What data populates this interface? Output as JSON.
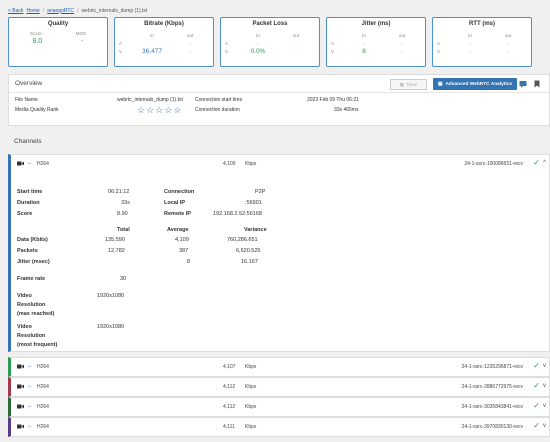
{
  "breadcrumb": {
    "back": "< Back",
    "home": "Home",
    "project": "anangoRTC",
    "file": "webrtc_internals_dump (1).txt"
  },
  "metrics": {
    "quality": {
      "title": "Quality",
      "score_label": "Score",
      "mos_label": "MOS",
      "score": "9.0",
      "mos": "-"
    },
    "bitrate": {
      "title": "Bitrate (Kbps)",
      "in_label": "In",
      "out_label": "out",
      "rows": [
        [
          "A",
          "-",
          "-"
        ],
        [
          "V",
          "36,477",
          "-"
        ]
      ]
    },
    "packet_loss": {
      "title": "Packet Loss",
      "in_label": "In",
      "out_label": "out",
      "rows": [
        [
          "A",
          "-",
          "-"
        ],
        [
          "V",
          "0.0%",
          "-"
        ]
      ]
    },
    "jitter": {
      "title": "Jitter (ms)",
      "in_label": "In",
      "out_label": "out",
      "rows": [
        [
          "A",
          "-",
          "-"
        ],
        [
          "V",
          "8",
          "-"
        ]
      ]
    },
    "rtt": {
      "title": "RTT (ms)",
      "in_label": "In",
      "out_label": "out",
      "rows": [
        [
          "A",
          "-",
          "-"
        ],
        [
          "V",
          "-",
          "-"
        ]
      ]
    }
  },
  "overview": {
    "title": "Overview",
    "trace_label": "Trace",
    "advanced_label": "Advanced WebRTC Analytics",
    "file_name_label": "File Name",
    "file_name": "webrtc_internals_dump (1).txt",
    "rank_label": "Media Quality Rank",
    "start_label": "Connection start time",
    "start_value": "2023 Feb 09 Thu 06:21",
    "duration_label": "Connection duration",
    "duration_value": "33s 465ms",
    "stars": [
      "☆",
      "☆",
      "☆",
      "☆",
      "☆"
    ]
  },
  "channels": {
    "title": "Channels",
    "expanded": {
      "codec": "H264",
      "kbps": "4,109",
      "unit": "Kbps",
      "ssrc": "24-1-ssrc-100086651-recv",
      "start_time_label": "Start time",
      "start_time": "06:21:12",
      "duration_label": "Duration",
      "duration": "33s",
      "score_label": "Score",
      "score": "8.90",
      "connection_label": "Connection",
      "connection": "P2P",
      "local_ip_label": "Local IP",
      "local_ip": ":56901",
      "remote_ip_label": "Remote IP",
      "remote_ip": "192.168.2.52:56168",
      "total_h": "Total",
      "average_h": "Average",
      "variance_h": "Variance",
      "rows": [
        {
          "label": "Data (Kbits)",
          "total": "135,590",
          "average": "4,109",
          "variance": "760,286.651"
        },
        {
          "label": "Packets",
          "total": "12,782",
          "average": "387",
          "variance": "6,620.525"
        },
        {
          "label": "Jitter (msec)",
          "total": "",
          "average": "8",
          "variance": "16.167"
        }
      ],
      "frame_rate_label": "Frame rate",
      "frame_rate": "30",
      "res_max_label_1": "Video",
      "res_max_label_2": "Resolution",
      "res_max_label_3": "(max reached)",
      "res_max": "1920x1080",
      "res_freq_label_1": "Video",
      "res_freq_label_2": "Resolution",
      "res_freq_label_3": "(most frequent)",
      "res_freq": "1920x1080"
    },
    "collapsed": [
      {
        "codec": "H264",
        "kbps": "4,107",
        "unit": "Kbps",
        "ssrc": "24-1-ssrc-1235296871-recv",
        "color": "#2e9a53"
      },
      {
        "codec": "H264",
        "kbps": "4,112",
        "unit": "Kbps",
        "ssrc": "24-1-ssrc-2886772975-recv",
        "color": "#a03a4a"
      },
      {
        "codec": "H264",
        "kbps": "4,112",
        "unit": "Kbps",
        "ssrc": "24-1-ssrc-3035843841-recv",
        "color": "#2d6b3a"
      },
      {
        "codec": "H264",
        "kbps": "4,111",
        "unit": "Kbps",
        "ssrc": "24-1-ssrc-3970830130-recv",
        "color": "#5a3a8a"
      }
    ]
  }
}
